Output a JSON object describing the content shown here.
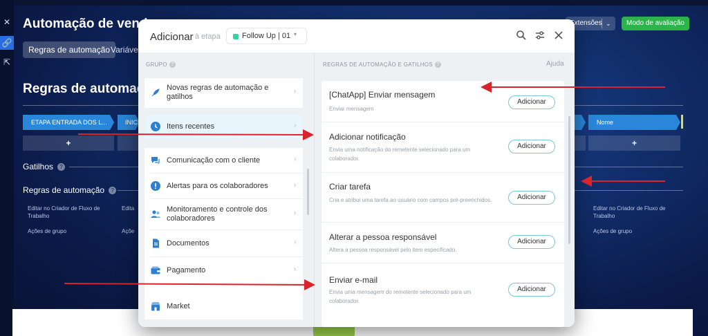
{
  "background": {
    "app_title": "Automação de venda",
    "tabs": [
      "Regras de automação",
      "Variáveis"
    ],
    "extensions_label": "Extensões",
    "eval_mode_label": "Modo de avaliação",
    "rules_heading": "Regras de automação",
    "stages": [
      "ETAPA ENTRADA DOS L...",
      "INIC",
      "Nome"
    ],
    "plus": "+",
    "triggers_label": "Gatilhos",
    "rules_label": "Regras de automação",
    "links": {
      "editor": "Editar no Criador de Fluxo de Trabalho",
      "editor_short": "Edita",
      "group_actions": "Ações de grupo",
      "group_actions_short": "Açõe"
    },
    "colors": {
      "stage_blue": "#2a86d8",
      "eval_green": "#2cb34a"
    }
  },
  "modal": {
    "title": "Adicionar",
    "subtitle": "à etapa",
    "stage_select": "Follow Up | 01",
    "group_header": "GRUPO",
    "rules_header": "REGRAS DE AUTOMAÇÃO E GATILHOS",
    "help": "Ajuda",
    "groups": [
      {
        "label": "Novas regras de automação e gatilhos",
        "icon": "rocket-icon"
      },
      {
        "label": "Itens recentes",
        "icon": "history-icon"
      },
      {
        "label": "Comunicação com o cliente",
        "icon": "chat-icon"
      },
      {
        "label": "Alertas para os colaboradores",
        "icon": "alert-icon"
      },
      {
        "label": "Monitoramento e controle dos colaboradores",
        "icon": "people-icon"
      },
      {
        "label": "Documentos",
        "icon": "document-icon"
      },
      {
        "label": "Pagamento",
        "icon": "wallet-icon"
      },
      {
        "label": "Market",
        "icon": "market-icon"
      }
    ],
    "rules": [
      {
        "title": "[ChatApp] Enviar mensagem",
        "desc": "Enviar mensagem",
        "button": "Adicionar"
      },
      {
        "title": "Adicionar notificação",
        "desc": "Envia uma notificação do remetente selecionado para um colaborador.",
        "button": "Adicionar"
      },
      {
        "title": "Criar tarefa",
        "desc": "Cria e atribui uma tarefa ao usuário com campos pré-preenchidos.",
        "button": "Adicionar"
      },
      {
        "title": "Alterar a pessoa responsável",
        "desc": "Altera a pessoa responsável pelo item especificado.",
        "button": "Adicionar"
      },
      {
        "title": "Enviar e-mail",
        "desc": "Envia uma mensagem do remetente selecionado para um colaborador.",
        "button": "Adicionar"
      }
    ],
    "colors": {
      "accent_teal": "#3bd0a0",
      "button_border": "#7fc6d4",
      "annotation_red": "#d9232d"
    }
  }
}
